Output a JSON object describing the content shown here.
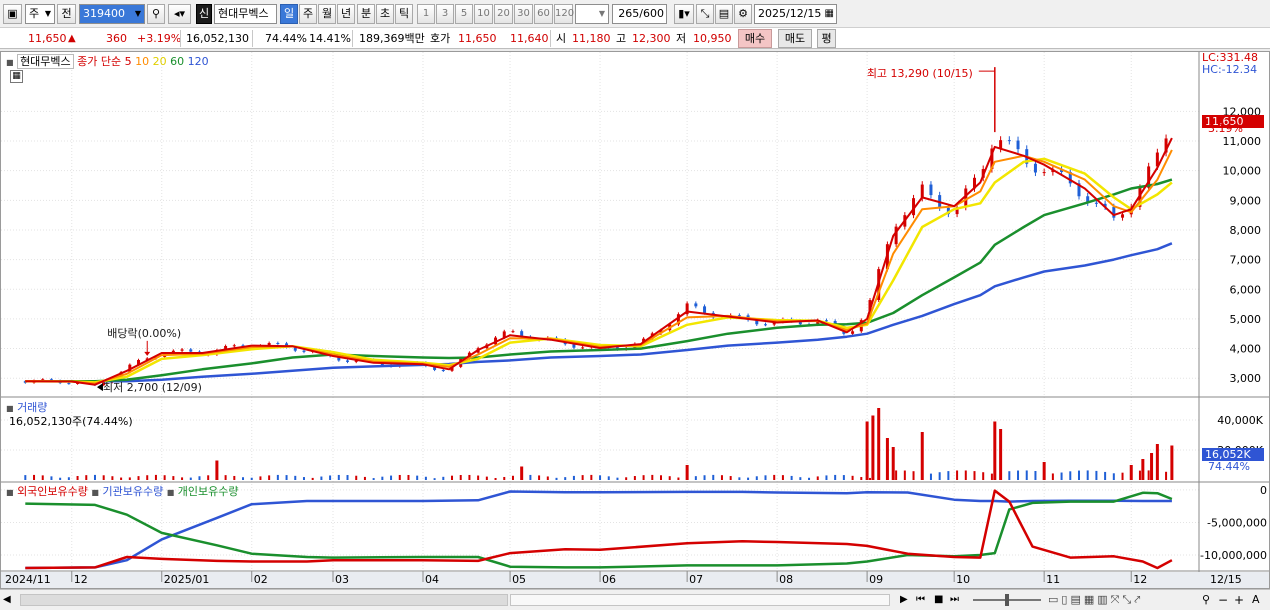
{
  "toolbar": {
    "market_type": "주",
    "period_type": "전",
    "stock_code": "319400",
    "new_badge": "신",
    "stock_name": "현대무벡스",
    "period_tabs": [
      "일",
      "주",
      "월",
      "년",
      "분",
      "초",
      "틱"
    ],
    "active_period": "일",
    "minute_tabs": [
      "1",
      "3",
      "5",
      "10",
      "20",
      "30",
      "60",
      "120"
    ],
    "bar_count": "265",
    "bar_max": "/600",
    "date": "2025/12/15"
  },
  "quote": {
    "price": "11,650",
    "change": "360",
    "change_pct": "+3.19%",
    "volume": "16,052,130",
    "volume_ratio": "74.44%",
    "turnover": "14.41%",
    "trade_value": "189,369백만",
    "bid_label": "호가",
    "ask": "11,650",
    "bid": "11,640",
    "open_label": "시",
    "open": "11,180",
    "high_label": "고",
    "high": "12,300",
    "low_label": "저",
    "low": "10,950",
    "buy_btn": "매수",
    "sell_btn": "매도",
    "eval_btn": "평"
  },
  "chart_data": [
    {
      "type": "line",
      "name": "price",
      "stock": "현대무벡스",
      "legend": {
        "label": "종가 단순",
        "periods": [
          "5",
          "10",
          "20",
          "60",
          "120"
        ]
      },
      "series_colors": {
        "price": "#d40000",
        "ma5": "#d40000",
        "ma10": "#ff8c00",
        "ma20": "#f2e600",
        "ma60": "#1a8f2d",
        "ma120": "#2f55d4",
        "candle_up": "#d40000",
        "candle_down": "#1f5fd6"
      },
      "ylim": [
        2400,
        13800
      ],
      "y_ticks": [
        3000,
        4000,
        5000,
        6000,
        7000,
        8000,
        9000,
        10000,
        11000,
        12000
      ],
      "y_tick_labels": [
        "3,000",
        "4,000",
        "5,000",
        "6,000",
        "7,000",
        "8,000",
        "9,000",
        "10,000",
        "11,000",
        "12,000"
      ],
      "right_info": {
        "lc": "LC:331.48",
        "hc": "HC:-12.34",
        "last": "11,650",
        "pct": "3.19%"
      },
      "annotations": {
        "max": {
          "label": "최고 13,290 (10/15)",
          "date": "2025-10-15",
          "value": 13290
        },
        "min": {
          "label": "최저 2,700 (12/09)",
          "date": "2024-12-09",
          "value": 2700
        },
        "dividend": {
          "label": "배당락(0.00%)",
          "date": "2024-12-27"
        }
      },
      "x_dates": [
        "2024-11-15",
        "2024-12-01",
        "2024-12-09",
        "2024-12-20",
        "2025-01-01",
        "2025-01-15",
        "2025-02-01",
        "2025-02-15",
        "2025-03-01",
        "2025-03-15",
        "2025-04-01",
        "2025-04-10",
        "2025-04-20",
        "2025-05-01",
        "2025-05-15",
        "2025-06-01",
        "2025-06-15",
        "2025-07-01",
        "2025-07-15",
        "2025-08-01",
        "2025-08-15",
        "2025-08-25",
        "2025-09-01",
        "2025-09-10",
        "2025-09-20",
        "2025-10-01",
        "2025-10-10",
        "2025-10-15",
        "2025-10-25",
        "2025-11-01",
        "2025-11-15",
        "2025-11-25",
        "2025-12-01",
        "2025-12-10",
        "2025-12-15"
      ],
      "close": [
        2900,
        2880,
        2720,
        3350,
        3900,
        3850,
        4150,
        4050,
        3700,
        3500,
        3450,
        3250,
        4100,
        4550,
        4250,
        4000,
        4150,
        5400,
        5050,
        4850,
        4950,
        4500,
        5200,
        8200,
        9300,
        8600,
        9900,
        11300,
        10300,
        10100,
        9200,
        8300,
        9000,
        10400,
        11650
      ],
      "ma5": [
        2900,
        2890,
        2780,
        3250,
        3850,
        3850,
        4100,
        4080,
        3750,
        3520,
        3470,
        3300,
        3950,
        4450,
        4300,
        4020,
        4150,
        5250,
        5080,
        4880,
        4950,
        4550,
        5000,
        7800,
        9100,
        8800,
        9600,
        10800,
        10500,
        10200,
        9400,
        8500,
        8700,
        10100,
        11100
      ],
      "ma10": [
        2900,
        2890,
        2820,
        3150,
        3780,
        3820,
        4050,
        4080,
        3800,
        3560,
        3490,
        3380,
        3800,
        4350,
        4330,
        4060,
        4120,
        5050,
        5100,
        4920,
        4930,
        4620,
        4850,
        7200,
        8700,
        8800,
        9300,
        10300,
        10500,
        10300,
        9700,
        8800,
        8600,
        9700,
        10700
      ],
      "ma20": [
        2900,
        2890,
        2860,
        3050,
        3650,
        3780,
        3980,
        4080,
        3880,
        3620,
        3520,
        3440,
        3650,
        4200,
        4340,
        4120,
        4080,
        4800,
        5050,
        4960,
        4940,
        4700,
        4800,
        6300,
        8100,
        8700,
        8900,
        9600,
        10300,
        10400,
        9900,
        9100,
        8700,
        9200,
        9600
      ],
      "ma60": [
        2900,
        2900,
        2900,
        2950,
        3100,
        3300,
        3500,
        3700,
        3800,
        3750,
        3700,
        3680,
        3700,
        3800,
        3900,
        3950,
        4000,
        4250,
        4500,
        4700,
        4800,
        4820,
        4870,
        5200,
        5800,
        6400,
        6900,
        7500,
        8100,
        8500,
        8900,
        9200,
        9400,
        9550,
        9700
      ],
      "ma120": [
        2900,
        2900,
        2900,
        2900,
        2950,
        3050,
        3150,
        3250,
        3350,
        3400,
        3450,
        3480,
        3550,
        3600,
        3700,
        3750,
        3800,
        3950,
        4100,
        4200,
        4300,
        4400,
        4500,
        4800,
        5100,
        5500,
        5800,
        6100,
        6400,
        6600,
        6800,
        7000,
        7150,
        7350,
        7550
      ]
    },
    {
      "type": "bar",
      "name": "volume",
      "title": "거래량",
      "summary": "16,052,130주(74.44%)",
      "unit": "K",
      "ylim": [
        0,
        48000
      ],
      "y_ticks": [
        20000,
        40000
      ],
      "y_tick_labels": [
        "20,000K",
        "40,000K"
      ],
      "last_label": "16,052K",
      "last_pct": "74.44%",
      "spikes": [
        {
          "date": "2025-01-20",
          "value": 13000
        },
        {
          "date": "2025-05-05",
          "value": 9000
        },
        {
          "date": "2025-07-01",
          "value": 10000
        },
        {
          "date": "2025-09-01",
          "value": 39000
        },
        {
          "date": "2025-09-03",
          "value": 43000
        },
        {
          "date": "2025-09-05",
          "value": 48000
        },
        {
          "date": "2025-09-08",
          "value": 28000
        },
        {
          "date": "2025-09-10",
          "value": 22000
        },
        {
          "date": "2025-09-20",
          "value": 32000
        },
        {
          "date": "2025-10-15",
          "value": 39000
        },
        {
          "date": "2025-10-17",
          "value": 34000
        },
        {
          "date": "2025-11-01",
          "value": 12000
        },
        {
          "date": "2025-12-01",
          "value": 10000
        },
        {
          "date": "2025-12-05",
          "value": 14000
        },
        {
          "date": "2025-12-08",
          "value": 18000
        },
        {
          "date": "2025-12-10",
          "value": 24000
        },
        {
          "date": "2025-12-15",
          "value": 23000
        }
      ]
    },
    {
      "type": "line",
      "name": "holdings",
      "legend": [
        "외국인보유수량",
        "기관보유수량",
        "개인보유수량"
      ],
      "colors": [
        "#d40000",
        "#2f55d4",
        "#1a8f2d"
      ],
      "ylim": [
        -12300000,
        600000
      ],
      "y_ticks": [
        0,
        -5000000,
        -10000000
      ],
      "y_tick_labels": [
        "0",
        "-5,000,000",
        "-10,000,000"
      ],
      "x_dates": [
        "2024-11-15",
        "2024-12-09",
        "2024-12-20",
        "2025-01-01",
        "2025-01-20",
        "2025-02-01",
        "2025-02-20",
        "2025-03-01",
        "2025-04-01",
        "2025-04-20",
        "2025-05-01",
        "2025-05-20",
        "2025-06-01",
        "2025-07-01",
        "2025-07-20",
        "2025-08-01",
        "2025-08-25",
        "2025-09-01",
        "2025-09-15",
        "2025-10-01",
        "2025-10-10",
        "2025-10-15",
        "2025-10-20",
        "2025-10-28",
        "2025-11-10",
        "2025-11-25",
        "2025-12-05",
        "2025-12-10",
        "2025-12-15"
      ],
      "foreign": [
        -12000000,
        -11900000,
        -10300000,
        -10600000,
        -10900000,
        -11000000,
        -11000000,
        -10800000,
        -10800000,
        -10900000,
        -9700000,
        -9100000,
        -9200000,
        -8200000,
        -7900000,
        -8000000,
        -8300000,
        -8600000,
        -9800000,
        -10300000,
        -10400000,
        -100000,
        -1800000,
        -8700000,
        -10400000,
        -10200000,
        -11000000,
        -12000000,
        -10800000
      ],
      "institution": [
        -12000000,
        -11900000,
        -10800000,
        -7600000,
        -4300000,
        -2200000,
        -1700000,
        -1700000,
        -1700000,
        -1600000,
        -250000,
        -350000,
        -350000,
        -300000,
        -300000,
        -400000,
        -500000,
        -350000,
        -400000,
        -1500000,
        -1700000,
        -1700000,
        -1800000,
        -1700000,
        -1650000,
        -1650000,
        -1700000,
        -1700000,
        -1700000
      ],
      "individual": [
        -2100000,
        -2300000,
        -3800000,
        -6600000,
        -8500000,
        -9800000,
        -10300000,
        -10400000,
        -10300000,
        -10300000,
        -11800000,
        -11900000,
        -11900000,
        -11600000,
        -11600000,
        -11600000,
        -11300000,
        -11000000,
        -10000000,
        -10200000,
        -10000000,
        -9700000,
        -3000000,
        -2000000,
        -1800000,
        -1800000,
        -450000,
        -500000,
        -1400000
      ]
    }
  ],
  "x_axis": {
    "labels": [
      "2024/11",
      "12",
      "2025/01",
      "02",
      "03",
      "04",
      "05",
      "06",
      "07",
      "08",
      "09",
      "10",
      "11",
      "12"
    ],
    "label_dates": [
      "2024-11-01",
      "2024-12-01",
      "2025-01-01",
      "2025-02-01",
      "2025-03-01",
      "2025-04-01",
      "2025-05-01",
      "2025-06-01",
      "2025-07-01",
      "2025-08-01",
      "2025-09-01",
      "2025-10-01",
      "2025-11-01",
      "2025-12-01"
    ],
    "right_label": "12/15"
  }
}
